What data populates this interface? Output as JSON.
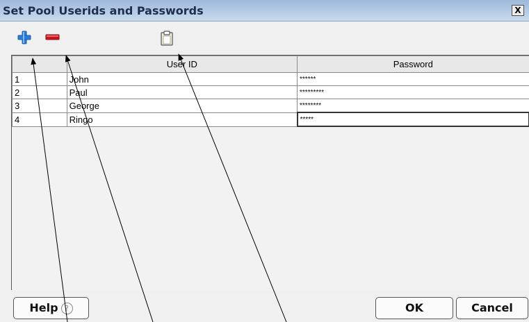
{
  "window": {
    "title": "Set Pool Userids and Passwords",
    "close_glyph": "X"
  },
  "toolbar": {
    "add_icon": "plus-icon",
    "remove_icon": "minus-icon",
    "paste_icon": "clipboard-icon",
    "add_color": "#2a7fd4",
    "remove_color": "#c8141e"
  },
  "table": {
    "headers": [
      "",
      "User ID",
      "Password"
    ],
    "rows": [
      {
        "num": "1",
        "user": "John",
        "password": "******"
      },
      {
        "num": "2",
        "user": "Paul",
        "password": "*********"
      },
      {
        "num": "3",
        "user": "George",
        "password": "********"
      },
      {
        "num": "4",
        "user": "Ringo",
        "password": "*****"
      }
    ]
  },
  "buttons": {
    "help": "Help",
    "help_glyph": "?",
    "ok": "OK",
    "cancel": "Cancel"
  }
}
